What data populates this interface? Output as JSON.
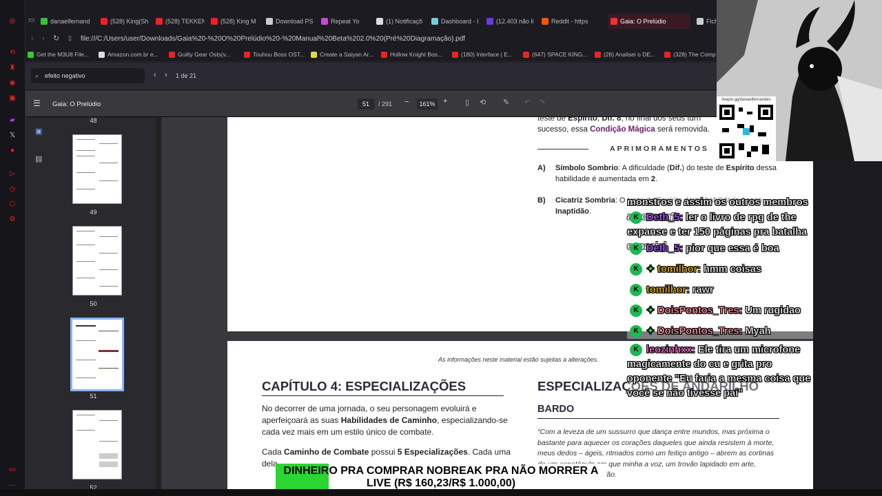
{
  "tabs": [
    {
      "label": "danaelfernand",
      "color": "#35c437"
    },
    {
      "label": "(528) King(Sh",
      "color": "#e22"
    },
    {
      "label": "(528) TEKKEN",
      "color": "#e22"
    },
    {
      "label": "(528) King M",
      "color": "#e22"
    },
    {
      "label": "Download PS",
      "color": "#ccc"
    },
    {
      "label": "Repeat Yo",
      "color": "#c24ad6"
    },
    {
      "label": "(1) Notificaçõ",
      "color": "#ddd"
    },
    {
      "label": "Dashboard - I",
      "color": "#7cd"
    },
    {
      "label": "(12.403 não li",
      "color": "#6a3ae0"
    },
    {
      "label": "Reddit - https",
      "color": "#f50"
    },
    {
      "label": "Gaia: O Prelúdio",
      "color": "#e33"
    },
    {
      "label": "Fich",
      "color": "#ccc"
    }
  ],
  "url": "file:///C:/Users/user/Downloads/Gaia%20-%20O%20Prelúdio%20-%20Manual%20Beta%202.0%20(Pré%20Diagramação).pdf",
  "bookmarks": [
    {
      "label": "Get the M3U8 File...",
      "color": "#3c3"
    },
    {
      "label": "Amazon.com.br e...",
      "color": "#ddd"
    },
    {
      "label": "Guilty Gear Osts(v...",
      "color": "#e22"
    },
    {
      "label": "Touhou Boss OST...",
      "color": "#e22"
    },
    {
      "label": "Create a Saiyan Ar...",
      "color": "#dd3"
    },
    {
      "label": "Hollow Knight Bos...",
      "color": "#e22"
    },
    {
      "label": "(180) Interface | E...",
      "color": "#e22"
    },
    {
      "label": "(647) SPACE KING...",
      "color": "#e22"
    },
    {
      "label": "(28) Analisei o DE...",
      "color": "#e22"
    },
    {
      "label": "(328) The Comp",
      "color": "#e22"
    }
  ],
  "find": {
    "query": "efeito negativo",
    "count": "1 de 21"
  },
  "pdf": {
    "title": "Gaia: O Prelúdio",
    "page": "51",
    "total": "/ 291",
    "zoom": "161%"
  },
  "thumbs": [
    {
      "label": "48"
    },
    {
      "label": "49"
    },
    {
      "label": "50"
    },
    {
      "label": "51"
    },
    {
      "label": "52"
    }
  ],
  "page1": {
    "top_text_1a": "teste de ",
    "top_b1": "Espírito",
    "top_text_1b": ", ",
    "top_b2": "Dif. 8",
    "top_text_1c": ", no final dos seus turn",
    "top_text_2a": "sucesso, essa ",
    "top_purple": "Condição Mágica",
    "top_text_2b": " será removida.",
    "aprimoramentos": "APRIMORAMENTOS",
    "a_label": "A)",
    "a_title": "Símbolo Sombrio",
    "a_text": ": A dificuldade (",
    "a_dif": "Dif.",
    "a_text2": ") do teste de ",
    "a_esp": "Espírito",
    "a_text3": " dessa",
    "a_text4": "habilidade é aumentada em ",
    "a_num": "2",
    "b_label": "B)",
    "b_title": "Cicatriz Sombria",
    "b_text": ": O teste de Espírito desta habilidade passa",
    "b_text2": "Inaptidão"
  },
  "page2": {
    "notice": "As informações neste material estão sujeitas a alterações.",
    "chapter": "CAPÍTULO 4: ESPECIALIZAÇÕES",
    "p1a": "No decorrer de uma jornada, o seu personagem evoluirá e",
    "p1b": "aperfeiçoará as suas ",
    "p1_bold": "Habilidades de Caminho",
    "p1c": ", especializando-se",
    "p1d": "cada vez mais em um estilo único de combate.",
    "p2a": "Cada ",
    "p2_bold1": "Caminho de Combate",
    "p2b": " possui ",
    "p2_bold2": "5 Especializações",
    "p2c": ". Cada uma",
    "p2d": "dela",
    "right_title": "ESPECIALIZAÇÕES DE ANDARILHO",
    "bardo": "BARDO",
    "quote1": "“Com a leveza de um sussurro que dança entre mundos, mas próxima o",
    "quote2": "bastante para aquecer os corações daqueles que ainda resistem à morte,",
    "quote3": "meus dedos – ágeis, ritmados como um feitiço antigo – abrem as cortinas",
    "quote4": "de um espetáculo em que minha a voz, um trovão lapidado em arte,",
    "quote5": "ecoa no centro do salão."
  },
  "chat": [
    {
      "user": "",
      "msg": "monstros e assim os outros membros atacarem?",
      "color": "#ffffff",
      "badge": false,
      "star": false
    },
    {
      "user": "Deth_5:",
      "msg": " ler o livro de rpg de the expanse e ter 150 páginas pra batalha espacial",
      "color": "#b05bff",
      "badge": true,
      "star": false
    },
    {
      "user": "Deth_5:",
      "msg": " pior que essa é boa",
      "color": "#b05bff",
      "badge": true,
      "star": false
    },
    {
      "user": "tomilhor:",
      "msg": " hmm coisas",
      "color": "#e8b400",
      "badge": true,
      "star": true
    },
    {
      "user": "tomilhor:",
      "msg": " rawr",
      "color": "#e8b400",
      "badge": true,
      "star": false
    },
    {
      "user": "DoisPontos_Tres:",
      "msg": " Um rugidao",
      "color": "#ff8fa3",
      "badge": true,
      "star": true
    },
    {
      "user": "DoisPontos_Tres:",
      "msg": " Myah",
      "color": "#ff8fa3",
      "badge": true,
      "star": true
    },
    {
      "user": "leozinhxx:",
      "msg": " Ele tira um microfone magicamente do cu e grita pro oponente \"Eu faria a mesma coisa que você se não tivesse pai\"",
      "color": "#ff6bd6",
      "badge": true,
      "star": false
    }
  ],
  "qr": {
    "url": "livepix.gg/danaelfernandes"
  },
  "donation": {
    "line1": "DINHEIRO PRA COMPRAR NOBREAK PRA NÃO MORRER A",
    "line2": "LIVE (R$ 160,23/R$ 1.000,00)",
    "progress": 0.16
  }
}
